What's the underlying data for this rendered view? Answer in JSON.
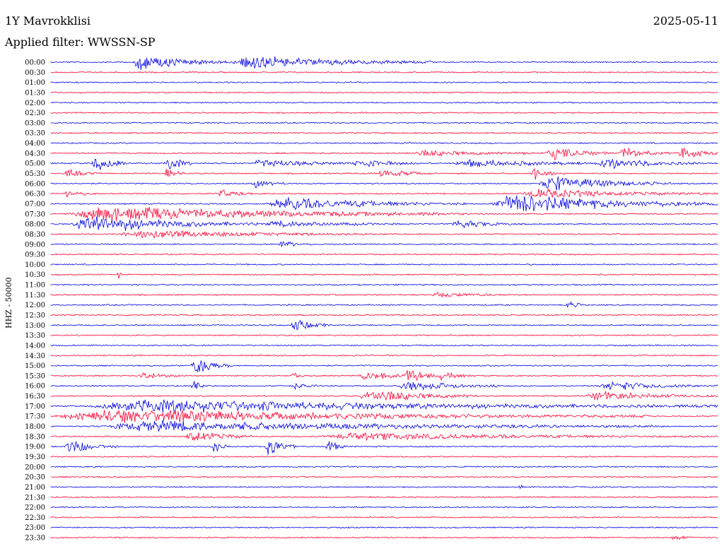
{
  "header": {
    "station": "1Y Mavrokklisi",
    "date": "2025-05-11",
    "filter_prefix": "Applied filter: ",
    "filter_name": "WWSSN-SP",
    "channel": "HHZ - 50000"
  },
  "colors": {
    "even_trace": "#0000e6",
    "odd_trace": "#ff0033",
    "background": "#ffffff",
    "text": "#000000"
  },
  "chart_data": {
    "type": "line",
    "title": "1Y Mavrokklisi",
    "ylabel": "HHZ - 50000",
    "rows": [
      {
        "time": "00:00",
        "activity": [
          [
            0.12,
            0.15,
            0.7
          ],
          [
            0.27,
            0.3,
            0.6
          ]
        ]
      },
      {
        "time": "00:30",
        "activity": []
      },
      {
        "time": "01:00",
        "activity": []
      },
      {
        "time": "01:30",
        "activity": []
      },
      {
        "time": "02:00",
        "activity": []
      },
      {
        "time": "02:30",
        "activity": []
      },
      {
        "time": "03:00",
        "activity": []
      },
      {
        "time": "03:30",
        "activity": []
      },
      {
        "time": "04:00",
        "activity": []
      },
      {
        "time": "04:30",
        "activity": [
          [
            0.54,
            0.2,
            0.25
          ],
          [
            0.74,
            0.1,
            0.6
          ],
          [
            0.85,
            0.08,
            0.5
          ],
          [
            0.94,
            0.06,
            0.6
          ]
        ]
      },
      {
        "time": "05:00",
        "activity": [
          [
            0.06,
            0.06,
            0.8
          ],
          [
            0.17,
            0.04,
            0.9
          ],
          [
            0.3,
            0.15,
            0.4
          ],
          [
            0.45,
            0.1,
            0.4
          ],
          [
            0.6,
            0.25,
            0.35
          ],
          [
            0.82,
            0.15,
            0.5
          ]
        ]
      },
      {
        "time": "05:30",
        "activity": [
          [
            0.02,
            0.05,
            0.4
          ],
          [
            0.17,
            0.03,
            0.6
          ],
          [
            0.49,
            0.08,
            0.4
          ],
          [
            0.72,
            0.05,
            0.6
          ]
        ]
      },
      {
        "time": "06:00",
        "activity": [
          [
            0.3,
            0.05,
            0.4
          ],
          [
            0.73,
            0.2,
            0.7
          ]
        ]
      },
      {
        "time": "06:30",
        "activity": [
          [
            0.02,
            0.05,
            0.3
          ],
          [
            0.25,
            0.05,
            0.4
          ],
          [
            0.7,
            0.3,
            0.4
          ]
        ]
      },
      {
        "time": "07:00",
        "activity": [
          [
            0.32,
            0.3,
            0.6
          ],
          [
            0.66,
            0.34,
            0.9
          ]
        ]
      },
      {
        "time": "07:30",
        "activity": [
          [
            0.02,
            0.6,
            0.7
          ]
        ]
      },
      {
        "time": "08:00",
        "activity": [
          [
            0.03,
            0.28,
            0.8
          ],
          [
            0.32,
            0.2,
            0.3
          ],
          [
            0.6,
            0.1,
            0.4
          ]
        ]
      },
      {
        "time": "08:30",
        "activity": [
          [
            0.1,
            0.38,
            0.4
          ]
        ]
      },
      {
        "time": "09:00",
        "activity": [
          [
            0.34,
            0.05,
            0.3
          ]
        ]
      },
      {
        "time": "09:30",
        "activity": []
      },
      {
        "time": "10:00",
        "activity": []
      },
      {
        "time": "10:30",
        "activity": [
          [
            0.1,
            0.01,
            0.4
          ]
        ]
      },
      {
        "time": "11:00",
        "activity": []
      },
      {
        "time": "11:30",
        "activity": [
          [
            0.57,
            0.12,
            0.2
          ]
        ]
      },
      {
        "time": "12:00",
        "activity": [
          [
            0.77,
            0.04,
            0.3
          ]
        ]
      },
      {
        "time": "12:30",
        "activity": []
      },
      {
        "time": "13:00",
        "activity": [
          [
            0.36,
            0.06,
            0.6
          ]
        ]
      },
      {
        "time": "13:30",
        "activity": []
      },
      {
        "time": "14:00",
        "activity": []
      },
      {
        "time": "14:30",
        "activity": []
      },
      {
        "time": "15:00",
        "activity": [
          [
            0.21,
            0.06,
            1.0
          ]
        ]
      },
      {
        "time": "15:30",
        "activity": [
          [
            0.13,
            0.07,
            0.3
          ],
          [
            0.36,
            0.02,
            0.4
          ],
          [
            0.46,
            0.1,
            0.4
          ],
          [
            0.53,
            0.05,
            0.9
          ],
          [
            0.58,
            0.05,
            0.4
          ]
        ]
      },
      {
        "time": "16:00",
        "activity": [
          [
            0.21,
            0.02,
            0.7
          ],
          [
            0.36,
            0.04,
            0.4
          ],
          [
            0.52,
            0.15,
            0.5
          ],
          [
            0.82,
            0.18,
            0.4
          ]
        ]
      },
      {
        "time": "16:30",
        "activity": [
          [
            0.46,
            0.18,
            0.6
          ],
          [
            0.8,
            0.2,
            0.4
          ]
        ]
      },
      {
        "time": "17:00",
        "activity": [
          [
            0.05,
            0.95,
            0.6
          ]
        ]
      },
      {
        "time": "17:30",
        "activity": [
          [
            0.0,
            0.9,
            0.6
          ]
        ]
      },
      {
        "time": "18:00",
        "activity": [
          [
            0.07,
            0.85,
            0.5
          ]
        ]
      },
      {
        "time": "18:30",
        "activity": [
          [
            0.2,
            0.1,
            0.6
          ],
          [
            0.4,
            0.6,
            0.3
          ]
        ]
      },
      {
        "time": "19:00",
        "activity": [
          [
            0.02,
            0.08,
            0.7
          ],
          [
            0.24,
            0.03,
            0.5
          ],
          [
            0.32,
            0.05,
            0.8
          ],
          [
            0.41,
            0.04,
            0.6
          ]
        ]
      },
      {
        "time": "19:30",
        "activity": []
      },
      {
        "time": "20:00",
        "activity": []
      },
      {
        "time": "20:30",
        "activity": []
      },
      {
        "time": "21:00",
        "activity": [
          [
            0.7,
            0.01,
            0.3
          ]
        ]
      },
      {
        "time": "21:30",
        "activity": []
      },
      {
        "time": "22:00",
        "activity": []
      },
      {
        "time": "22:30",
        "activity": []
      },
      {
        "time": "23:00",
        "activity": []
      },
      {
        "time": "23:30",
        "activity": [
          [
            0.93,
            0.03,
            0.3
          ]
        ]
      }
    ]
  }
}
